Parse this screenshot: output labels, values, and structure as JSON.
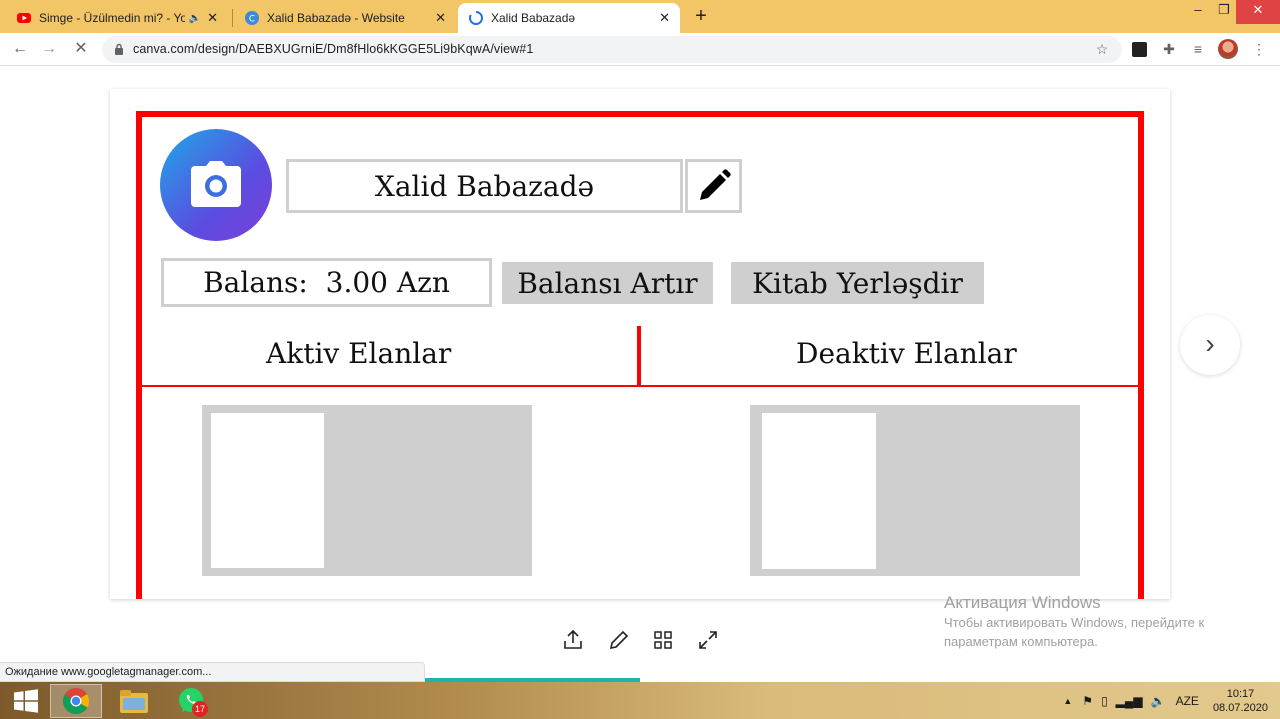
{
  "tabs": [
    {
      "title": "Simge - Üzülmedin mi? - YouTube",
      "favicon": "youtube-icon",
      "audio": true
    },
    {
      "title": "Xalid Babazadə - Website",
      "favicon": "canva-icon"
    },
    {
      "title": "Xalid Babazadə",
      "favicon": "loading-spinner-icon",
      "active": true
    }
  ],
  "toolbar": {
    "url": "canva.com/design/DAEBXUGrniE/Dm8fHlo6kKGGE5Li9bKqwA/view#1"
  },
  "profile": {
    "name": "Xalid Babazadə",
    "balance_text": "Balans:  3.00 Azn",
    "topup_label": "Balansı Artır",
    "place_book_label": "Kitab Yerləşdir",
    "active_ads_label": "Aktiv Elanlar",
    "inactive_ads_label": "Deaktiv Elanlar"
  },
  "status_text": "Ожидание www.googletagmanager.com...",
  "watermark": {
    "title": "Активация Windows",
    "line1": "Чтобы активировать Windows, перейдите к",
    "line2": "параметрам компьютера."
  },
  "taskbar": {
    "whatsapp_badge": "17",
    "language": "AZE",
    "time": "10:17",
    "date": "08.07.2020"
  },
  "colors": {
    "frame_red": "#ff0000",
    "title_bar": "#f2c566",
    "button_gray": "#cfcfcf",
    "avatar_gradient_start": "#1fa8e8",
    "avatar_gradient_end": "#7b3fd9"
  }
}
